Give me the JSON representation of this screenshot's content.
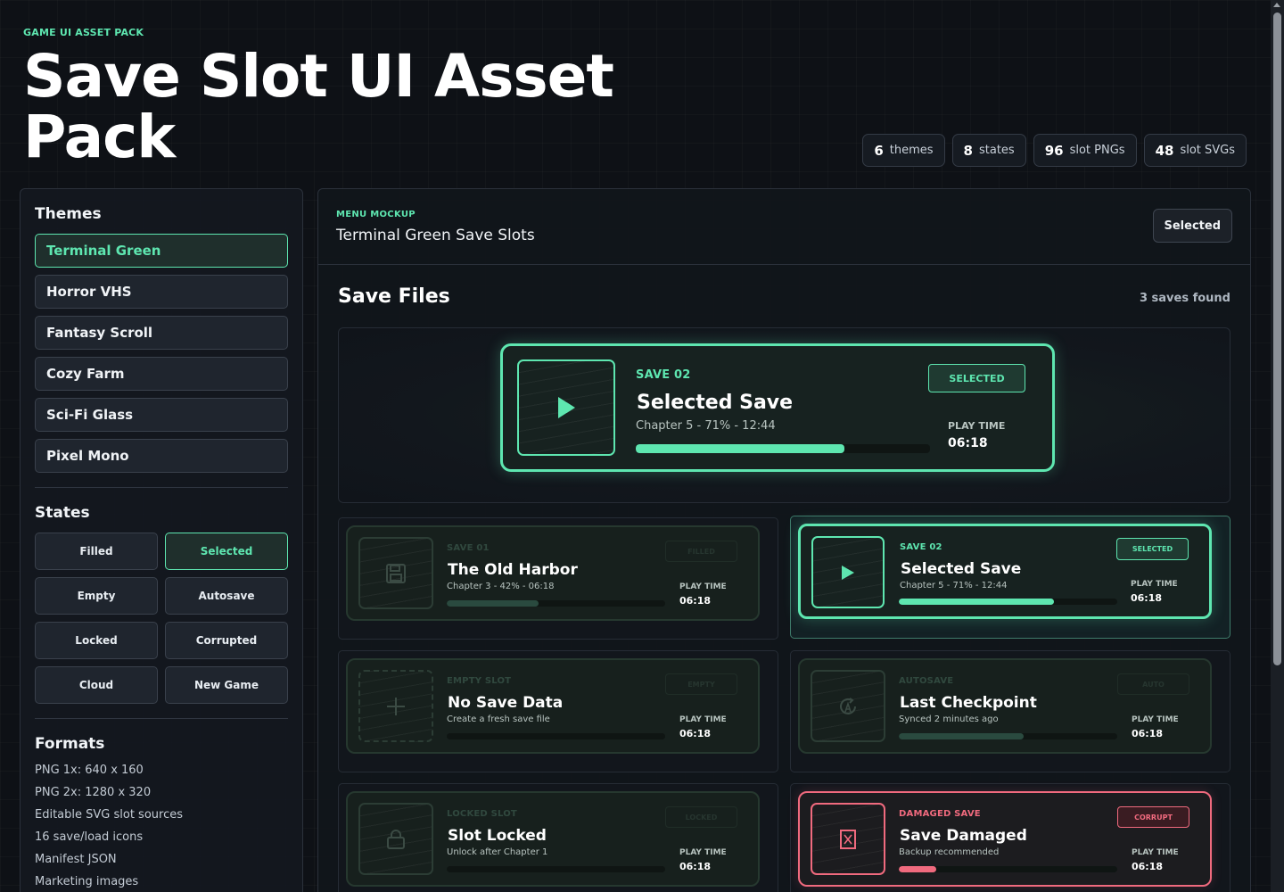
{
  "header": {
    "eyebrow": "GAME UI ASSET PACK",
    "title": "Save Slot UI Asset Pack",
    "stats": [
      {
        "value": "6",
        "label": "themes"
      },
      {
        "value": "8",
        "label": "states"
      },
      {
        "value": "96",
        "label": "slot PNGs"
      },
      {
        "value": "48",
        "label": "slot SVGs"
      }
    ]
  },
  "sidebar": {
    "themes_heading": "Themes",
    "themes": [
      "Terminal Green",
      "Horror VHS",
      "Fantasy Scroll",
      "Cozy Farm",
      "Sci-Fi Glass",
      "Pixel Mono"
    ],
    "active_theme": "Terminal Green",
    "states_heading": "States",
    "states": [
      "Filled",
      "Selected",
      "Empty",
      "Autosave",
      "Locked",
      "Corrupted",
      "Cloud",
      "New Game"
    ],
    "active_state": "Selected",
    "formats_heading": "Formats",
    "formats": [
      "PNG 1x: 640 x 160",
      "PNG 2x: 1280 x 320",
      "Editable SVG slot sources",
      "16 save/load icons",
      "Manifest JSON",
      "Marketing images"
    ]
  },
  "main": {
    "eyebrow": "MENU MOCKUP",
    "title": "Terminal Green Save Slots",
    "state_button": "Selected",
    "section_title": "Save Files",
    "count": "3 saves found",
    "play_time_label": "PLAY TIME",
    "hero": {
      "label": "SAVE 02",
      "name": "Selected Save",
      "sub": "Chapter 5 - 71% - 12:44",
      "badge": "SELECTED",
      "time": "06:18",
      "progress": 0.71
    },
    "slots": [
      {
        "label": "SAVE 01",
        "name": "The Old Harbor",
        "sub": "Chapter 3 - 42% - 06:18",
        "badge": "FILLED",
        "time": "06:18",
        "progress": 0.42,
        "icon": "floppy-disk-icon",
        "variant": "dim"
      },
      {
        "label": "SAVE 02",
        "name": "Selected Save",
        "sub": "Chapter 5 - 71% - 12:44",
        "badge": "SELECTED",
        "time": "06:18",
        "progress": 0.71,
        "icon": "play-icon",
        "variant": "sel"
      },
      {
        "label": "EMPTY SLOT",
        "name": "No Save Data",
        "sub": "Create a fresh save file",
        "badge": "EMPTY",
        "time": "06:18",
        "progress": 0,
        "icon": "plus-icon",
        "variant": "dim"
      },
      {
        "label": "AUTOSAVE",
        "name": "Last Checkpoint",
        "sub": "Synced 2 minutes ago",
        "badge": "AUTO",
        "time": "06:18",
        "progress": 0.57,
        "icon": "autosave-icon",
        "variant": "dim"
      },
      {
        "label": "LOCKED SLOT",
        "name": "Slot Locked",
        "sub": "Unlock after Chapter 1",
        "badge": "LOCKED",
        "time": "06:18",
        "progress": 0,
        "icon": "lock-icon",
        "variant": "dim"
      },
      {
        "label": "DAMAGED SAVE",
        "name": "Save Damaged",
        "sub": "Backup recommended",
        "badge": "CORRUPT",
        "time": "06:18",
        "progress": 0.17,
        "icon": "corrupt-file-icon",
        "variant": "corrupt"
      }
    ]
  },
  "colors": {
    "accent": "#5ee6b0",
    "danger": "#f06a7e",
    "background": "#0e1116"
  }
}
